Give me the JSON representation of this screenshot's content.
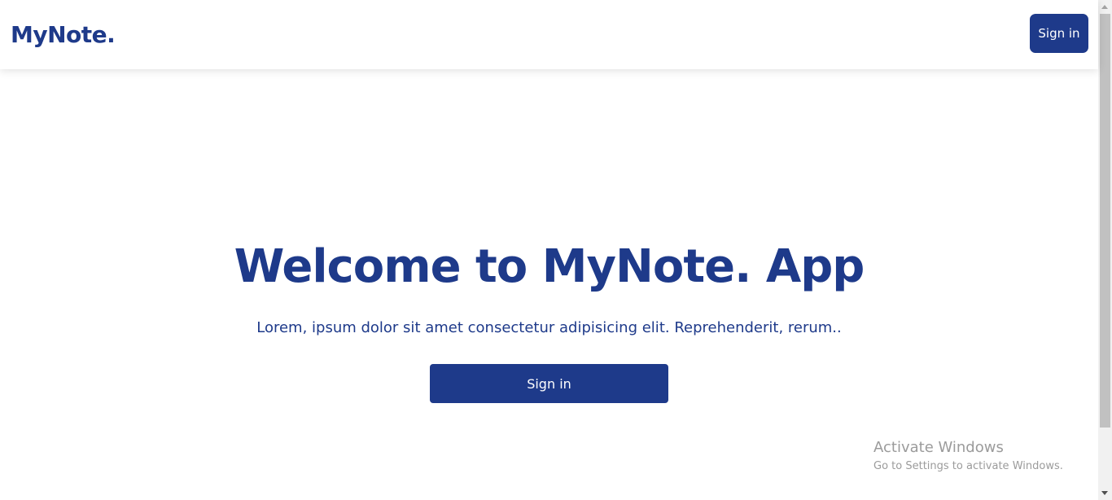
{
  "colors": {
    "brand": "#1e3a8a",
    "background": "#ffffff",
    "button_text": "#ffffff"
  },
  "navbar": {
    "brand": "MyNote.",
    "sign_in_label": "Sign in"
  },
  "hero": {
    "title": "Welcome to MyNote. App",
    "subtitle": "Lorem, ipsum dolor sit amet consectetur adipisicing elit. Reprehenderit, rerum..",
    "sign_in_label": "Sign in"
  },
  "watermark": {
    "title": "Activate Windows",
    "subtitle": "Go to Settings to activate Windows."
  },
  "scrollbar": {
    "up_icon": "chevron-up-icon",
    "down_icon": "chevron-down-icon"
  }
}
